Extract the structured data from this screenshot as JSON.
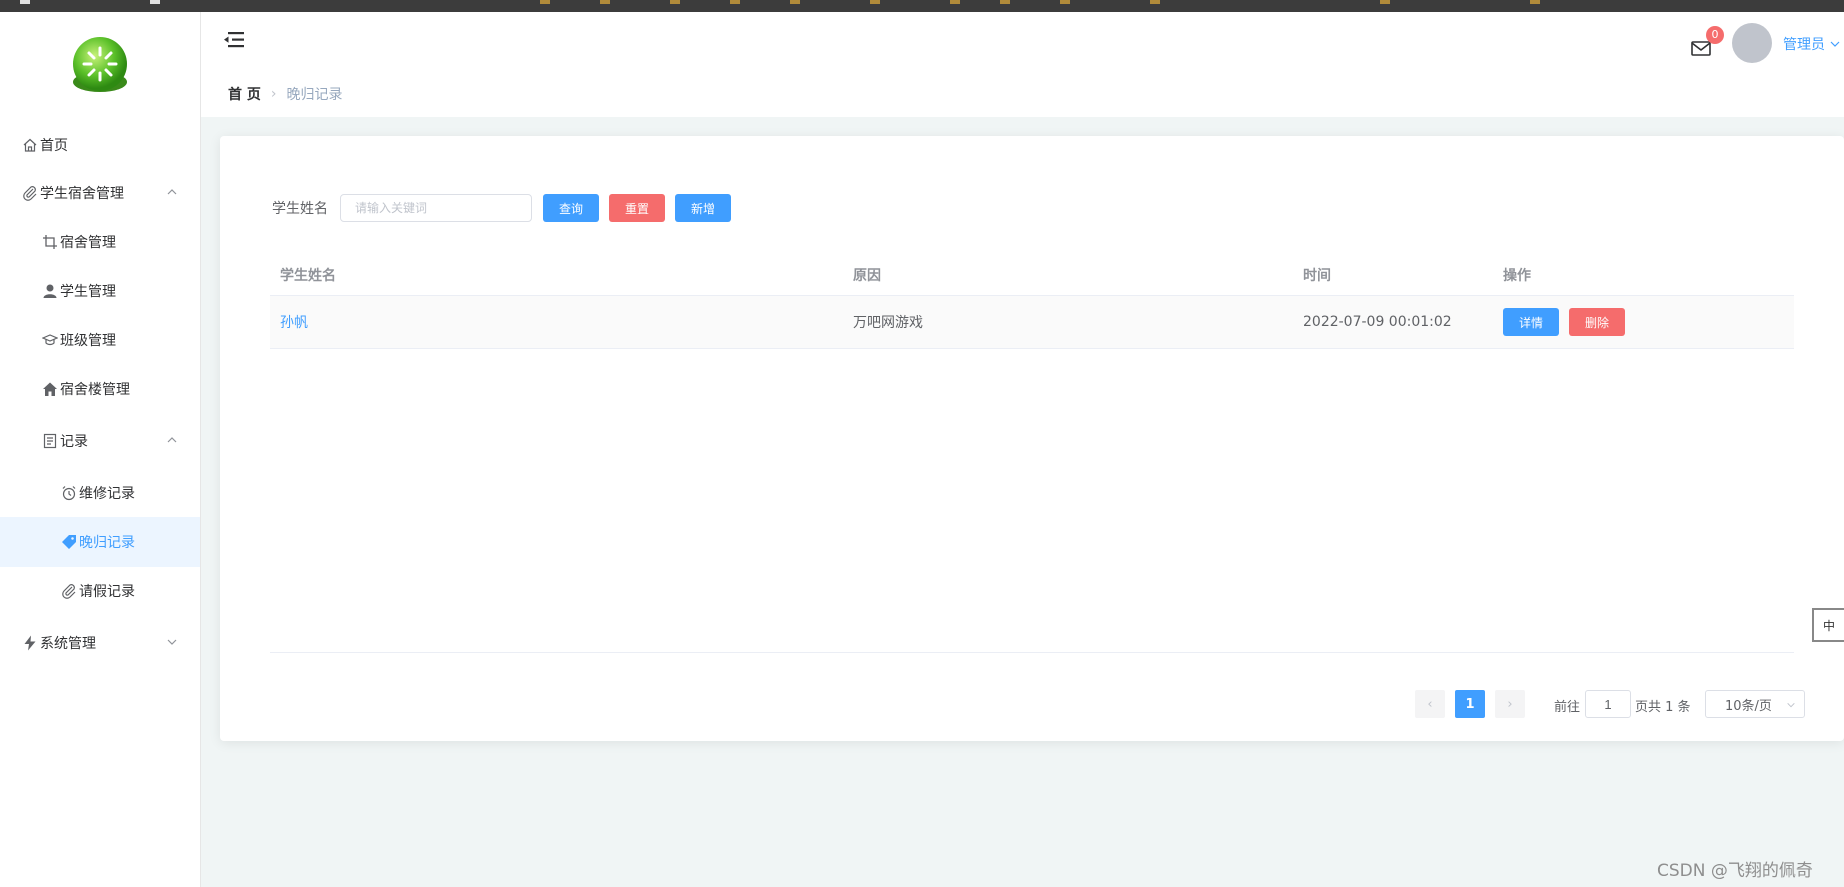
{
  "app": {
    "user_name": "管理员",
    "mail_badge": "0"
  },
  "sidebar": {
    "items": [
      {
        "label": "首页",
        "icon": "home-icon"
      },
      {
        "label": "学生宿舍管理",
        "icon": "paperclip-icon"
      },
      {
        "label": "宿舍管理",
        "icon": "crop-icon"
      },
      {
        "label": "学生管理",
        "icon": "user-icon"
      },
      {
        "label": "班级管理",
        "icon": "graduation-cap-icon"
      },
      {
        "label": "宿舍楼管理",
        "icon": "house-icon"
      },
      {
        "label": "记录",
        "icon": "document-icon"
      },
      {
        "label": "维修记录",
        "icon": "alarm-clock-icon"
      },
      {
        "label": "晚归记录",
        "icon": "price-tag-icon",
        "active": true
      },
      {
        "label": "请假记录",
        "icon": "paperclip-icon"
      },
      {
        "label": "系统管理",
        "icon": "lightning-icon"
      }
    ]
  },
  "breadcrumb": {
    "home": "首 页",
    "current": "晚归记录"
  },
  "search": {
    "label": "学生姓名",
    "placeholder": "请输入关键词",
    "value": "",
    "query_button": "查询",
    "reset_button": "重置",
    "add_button": "新增"
  },
  "table": {
    "headers": [
      "学生姓名",
      "原因",
      "时间",
      "操作"
    ],
    "rows": [
      {
        "name": "孙帆",
        "reason": "万吧网游戏",
        "time": "2022-07-09 00:01:02",
        "detail_label": "详情",
        "delete_label": "删除"
      }
    ]
  },
  "pagination": {
    "prev": "‹",
    "next": "›",
    "current_page": "1",
    "goto_label": "前往",
    "goto_value": "1",
    "total_text": "页共 1 条",
    "page_size": "10条/页"
  },
  "ime_indicator": "中",
  "watermark": "CSDN @飞翔的佩奇",
  "colors": {
    "primary": "#409eff",
    "danger": "#f56c6c",
    "active_bg": "#ecf5ff",
    "content_bg": "#f0f5f5"
  }
}
